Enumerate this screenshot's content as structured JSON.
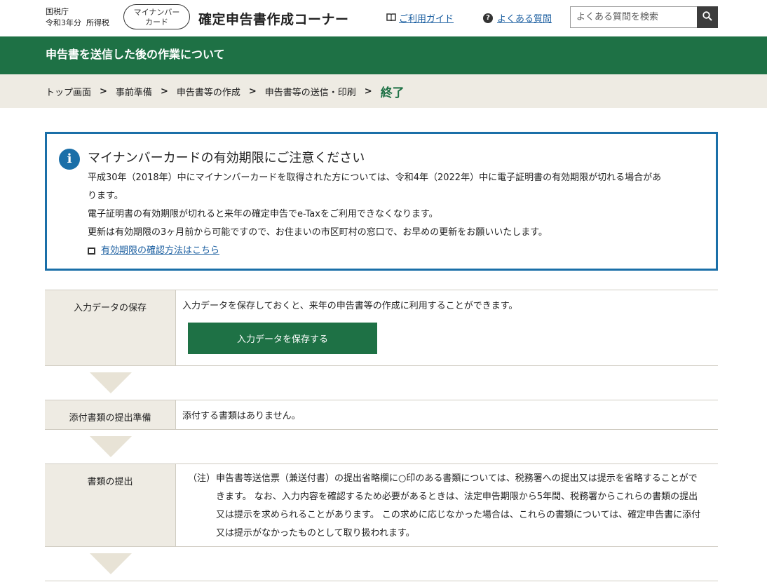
{
  "header": {
    "agency": "国税庁",
    "tax_year": "令和3年分",
    "tax_type": "所得税",
    "badge_line1": "マイナンバー",
    "badge_line2": "カード",
    "site_title": "確定申告書作成コーナー",
    "guide_label": "ご利用ガイド",
    "faq_label": "よくある質問",
    "search_placeholder": "よくある質問を検索",
    "icons": {
      "guide": "book-icon",
      "faq": "question-icon",
      "search": "search-icon"
    }
  },
  "title_bar": {
    "text": "申告書を送信した後の作業について"
  },
  "breadcrumb": {
    "items": [
      "トップ画面",
      "事前準備",
      "申告書等の作成",
      "申告書等の送信・印刷",
      "終了"
    ]
  },
  "notice": {
    "icon": "info-icon",
    "title": "マイナンバーカードの有効期限にご注意ください",
    "lines": [
      "平成30年（2018年）中にマイナンバーカードを取得された方については、令和4年（2022年）中に電子証明書の有効期限が切れる場合があ",
      "ります。",
      "電子証明書の有効期限が切れると来年の確定申告でe-Taxをご利用できなくなります。",
      "更新は有効期限の3ヶ月前から可能ですので、お住まいの市区町村の窓口で、お早めの更新をお願いいたします。"
    ],
    "link_label": "有効期限の確認方法はこちら"
  },
  "steps": [
    {
      "label": "入力データの保存",
      "text": "入力データを保存しておくと、来年の申告書等の作成に利用することができます。",
      "button": "入力データを保存する"
    },
    {
      "label": "添付書類の提出準備",
      "text": "添付する書類はありません。"
    },
    {
      "label": "書類の提出",
      "note_mark": "（注）",
      "note_text": "申告書等送信票（兼送付書）の提出省略欄に○印のある書類については、税務署への提出又は提示を省略することができます。 なお、入力内容を確認するため必要があるときは、法定申告期限から5年間、税務署からこれらの書類の提出又は提示を求められることがあります。 この求めに応じなかった場合は、これらの書類については、確定申告書に添付又は提示がなかったものとして取り扱われます。"
    }
  ],
  "colors": {
    "brand_green": "#1e7145",
    "notice_blue": "#1a6fa8",
    "beige": "#eeebe3"
  }
}
